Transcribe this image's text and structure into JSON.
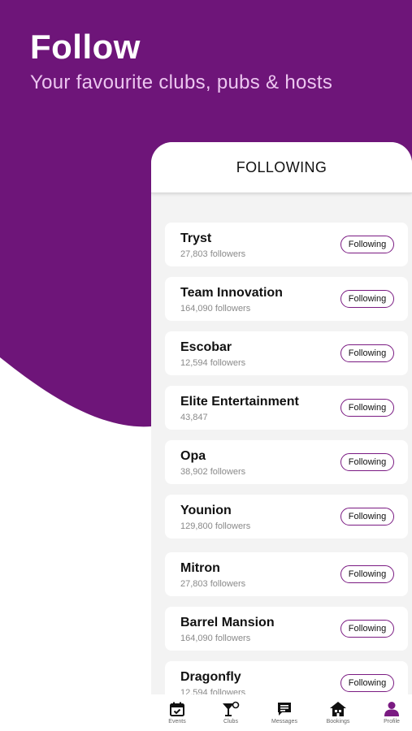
{
  "hero": {
    "title": "Follow",
    "subtitle": "Your favourite clubs, pubs & hosts"
  },
  "panel": {
    "header": "FOLLOWING",
    "button_label": "Following",
    "items": [
      {
        "name": "Tryst",
        "followers": "27,803 followers"
      },
      {
        "name": "Team Innovation",
        "followers": "164,090 followers"
      },
      {
        "name": "Escobar",
        "followers": "12,594 followers"
      },
      {
        "name": "Elite Entertainment",
        "followers": "43,847"
      },
      {
        "name": "Opa",
        "followers": "38,902 followers"
      },
      {
        "name": "Younion",
        "followers": "129,800 followers"
      },
      {
        "name": "Mitron",
        "followers": "27,803 followers"
      },
      {
        "name": "Barrel Mansion",
        "followers": "164,090 followers"
      },
      {
        "name": "Dragonfly",
        "followers": "12,594 followers"
      }
    ]
  },
  "tabbar": {
    "tabs": [
      {
        "label": "Events",
        "icon": "calendar-icon"
      },
      {
        "label": "Clubs",
        "icon": "cocktail-icon"
      },
      {
        "label": "Messages",
        "icon": "chat-icon"
      },
      {
        "label": "Bookings",
        "icon": "house-icon"
      },
      {
        "label": "Profile",
        "icon": "person-icon"
      }
    ],
    "active": "Profile"
  },
  "colors": {
    "brand_purple": "#6e1579",
    "subtitle_pink": "#ecc6f0",
    "button_border": "#7a1a82",
    "panel_bg": "#f3f3f3"
  }
}
